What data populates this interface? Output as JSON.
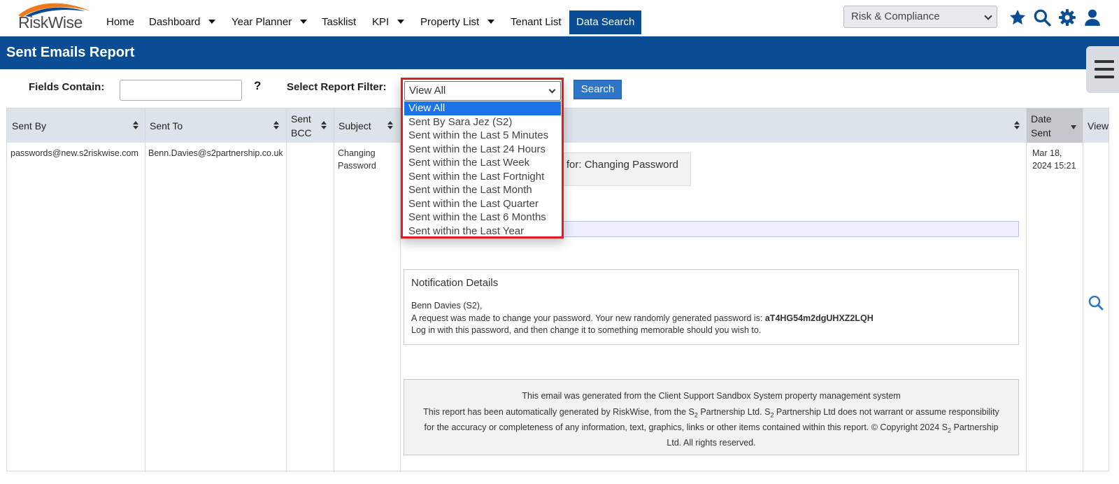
{
  "brand": {
    "logo_text": "RiskWise",
    "colors": {
      "primary": "#0a4d95",
      "accent_orange": "#f07a1a",
      "highlight_red": "#e31b23"
    }
  },
  "nav": {
    "items": [
      {
        "label": "Home",
        "has_caret": false
      },
      {
        "label": "Dashboard",
        "has_caret": true
      },
      {
        "label": "Year Planner",
        "has_caret": true
      },
      {
        "label": "Tasklist",
        "has_caret": false
      },
      {
        "label": "KPI",
        "has_caret": true
      },
      {
        "label": "Property List",
        "has_caret": true
      },
      {
        "label": "Tenant List",
        "has_caret": false
      },
      {
        "label": "Data Search",
        "has_caret": false,
        "active": true
      }
    ],
    "role_select": {
      "value": "Risk & Compliance"
    },
    "icons": [
      "star-icon",
      "search-icon",
      "gear-icon",
      "user-icon"
    ]
  },
  "page": {
    "title": "Sent Emails Report",
    "menu_icon": "hamburger-icon"
  },
  "filters": {
    "fields_contain_label": "Fields Contain:",
    "fields_contain_value": "",
    "help": "?",
    "report_filter_label": "Select Report Filter:",
    "report_filter_value": "View All",
    "options": [
      "View All",
      "Sent By Sara Jez (S2)",
      "Sent within the Last 5 Minutes",
      "Sent within the Last 24 Hours",
      "Sent within the Last Week",
      "Sent within the Last Fortnight",
      "Sent within the Last Month",
      "Sent within the Last Quarter",
      "Sent within the Last 6 Months",
      "Sent within the Last Year"
    ],
    "search_button": "Search"
  },
  "table": {
    "headers": {
      "sent_by": "Sent By",
      "sent_to": "Sent To",
      "sent_bcc_1": "Sent",
      "sent_bcc_2": "BCC",
      "subject": "Subject",
      "date_sent_1": "Date",
      "date_sent_2": "Sent",
      "view": "View"
    },
    "rows": [
      {
        "sent_by": "passwords@new.s2riskwise.com",
        "sent_to": "Benn.Davies@s2partnership.co.uk",
        "sent_bcc": "",
        "subject_1": "Changing",
        "subject_2": "Password",
        "email_subject_fragment": "on for: Changing Password",
        "date_1": "Mar 18,",
        "date_2": "2024 15:21",
        "notification": {
          "heading": "Notification Details",
          "greeting": "Benn Davies (S2),",
          "line1_prefix": "A request was made to change your password. Your new randomly generated password is: ",
          "password": "aT4HG54m2dgUHXZ2LQH",
          "line2": "Log in with this password, and then change it to something memorable should you wish to."
        },
        "footer": {
          "line1": "This email was generated from the Client Support Sandbox System property management system",
          "line2a": "This report has been automatically generated by RiskWise, from the S",
          "sub": "2",
          "line2b": " Partnership Ltd. S",
          "line2c": " Partnership Ltd does not warrant or assume responsibility",
          "line3a": "for the accuracy or completeness of any information, text, graphics, links or other items contained within this report. © Copyright 2024 S",
          "line3b": " Partnership",
          "line4": "Ltd. All rights reserved."
        }
      }
    ]
  }
}
